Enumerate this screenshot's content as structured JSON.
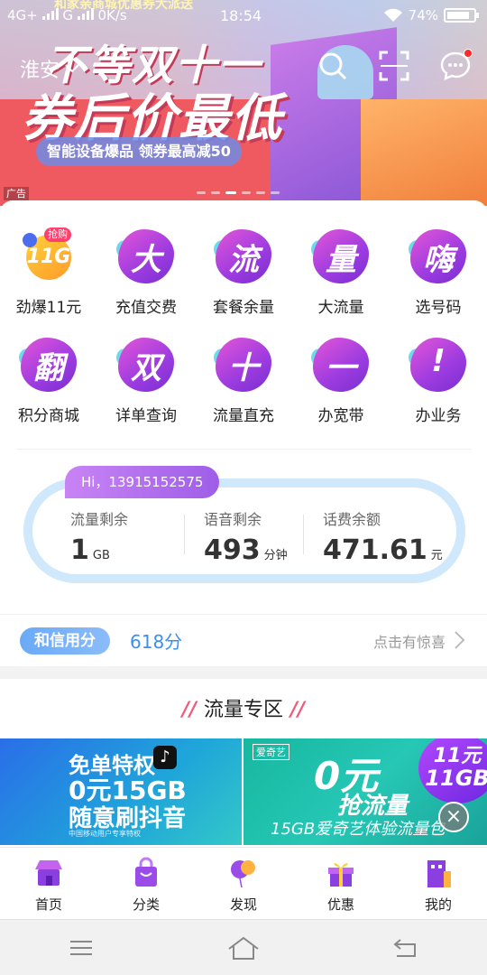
{
  "status_bar": {
    "network": "4G+",
    "network2": "G",
    "speed": "0K/s",
    "time": "18:54",
    "battery": "74%"
  },
  "banner": {
    "top_line": "和家亲商城优惠券大派送",
    "headline1": "不等双十一",
    "headline2": "券后价最低",
    "pill": "智能设备爆品 领券最高减50",
    "ad_tag": "广告",
    "slide_count": 6,
    "active_slide": 3
  },
  "header": {
    "city": "淮安",
    "icons": [
      "search-icon",
      "scan-icon",
      "message-icon"
    ]
  },
  "services": [
    [
      {
        "label": "劲爆11元",
        "glyph": "11G",
        "tag": "抢购",
        "special": true
      },
      {
        "label": "充值交费",
        "glyph": "大"
      },
      {
        "label": "套餐余量",
        "glyph": "流"
      },
      {
        "label": "大流量",
        "glyph": "量"
      },
      {
        "label": "选号码",
        "glyph": "嗨"
      }
    ],
    [
      {
        "label": "积分商城",
        "glyph": "翻"
      },
      {
        "label": "详单查询",
        "glyph": "双"
      },
      {
        "label": "流量直充",
        "glyph": "十"
      },
      {
        "label": "办宽带",
        "glyph": "一"
      },
      {
        "label": "办业务",
        "glyph": "!"
      }
    ]
  ],
  "balance": {
    "greeting": "Hi，13915152575",
    "items": [
      {
        "label": "流量剩余",
        "value": "1",
        "unit": "GB"
      },
      {
        "label": "语音剩余",
        "value": "493",
        "unit": "分钟"
      },
      {
        "label": "话费余额",
        "value": "471.61",
        "unit": "元"
      }
    ]
  },
  "credit": {
    "badge": "和信用分",
    "score": "618分",
    "hint": "点击有惊喜"
  },
  "zone": {
    "title": "流量专区",
    "promo1": {
      "line1": "免单特权",
      "line2": "0元15GB",
      "line3": "随意刷抖音",
      "line4": "中国移动用户专享特权"
    },
    "promo2": {
      "brand": "爱奇艺",
      "line1": "0元",
      "line2": "抢流量",
      "line3": "15GB爱奇艺体验流量包",
      "seal1": "11元",
      "seal2": "11GB"
    }
  },
  "nav": [
    {
      "label": "首页",
      "icon": "home-shop-icon"
    },
    {
      "label": "分类",
      "icon": "bag-icon"
    },
    {
      "label": "发现",
      "icon": "balloon-icon"
    },
    {
      "label": "优惠",
      "icon": "gift-icon"
    },
    {
      "label": "我的",
      "icon": "building-icon"
    }
  ],
  "colors": {
    "accent_blue": "#3a8ff0",
    "purple": "#9b3be0",
    "ring": "#cfe8fb"
  }
}
